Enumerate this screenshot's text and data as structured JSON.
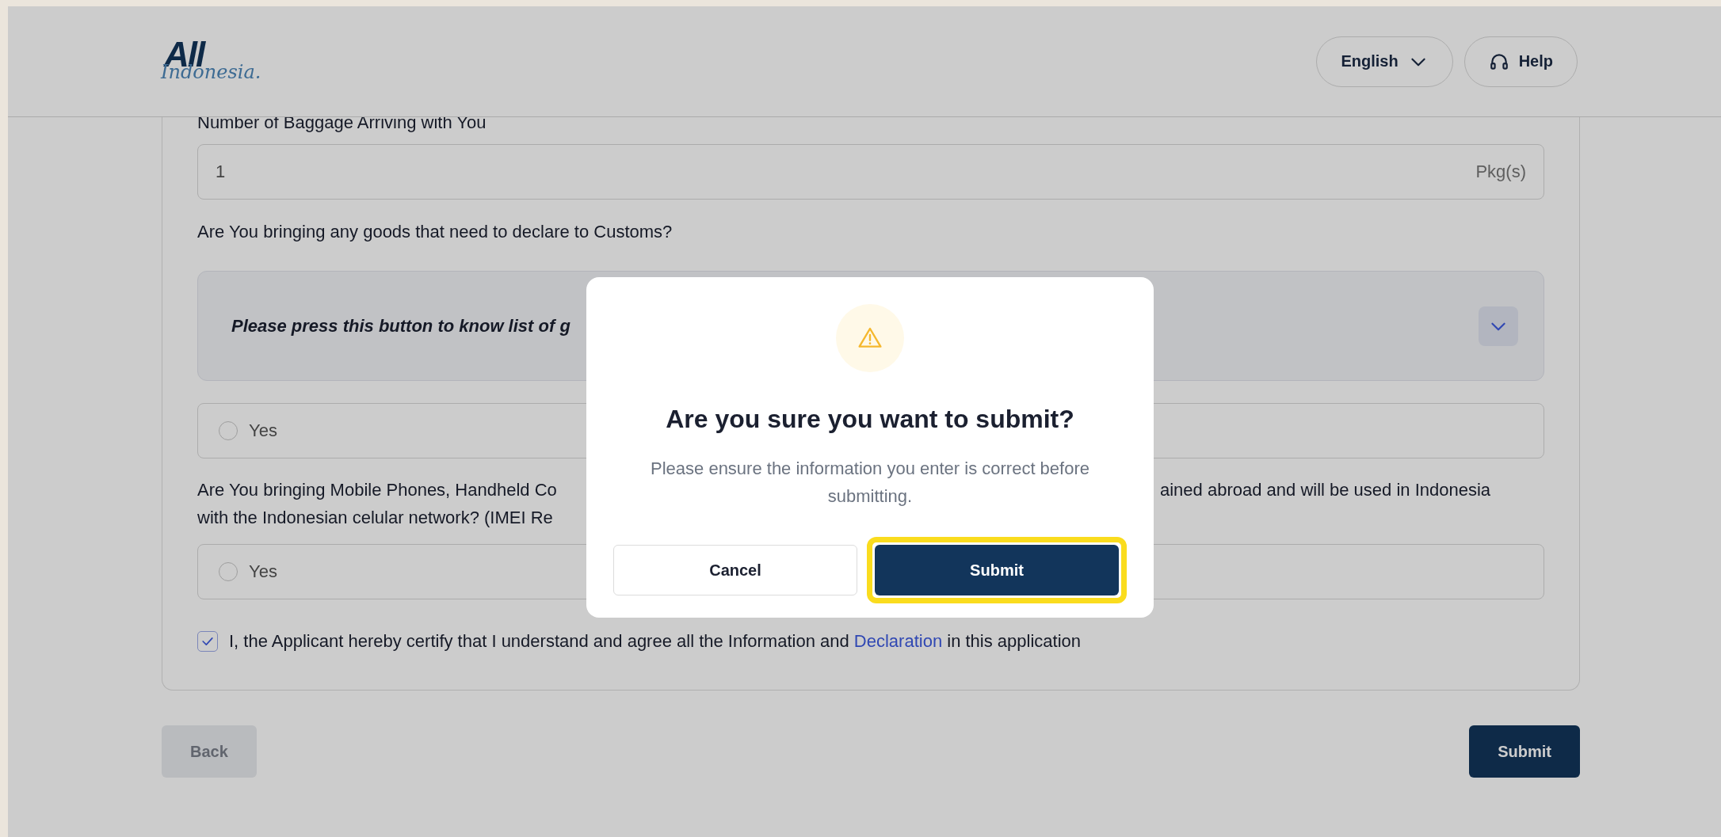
{
  "header": {
    "logo": {
      "bold": "All",
      "script": "Indonesia."
    },
    "language": "English",
    "help": "Help"
  },
  "baggage": {
    "label": "Number of Baggage Arriving with You",
    "value": "1",
    "unit": "Pkg(s)"
  },
  "customs": {
    "question": "Are You bringing any goods that need to declare to Customs?",
    "info": {
      "text": "Please press this button to know list of g",
      "expanded": false
    },
    "options": [
      {
        "label": "Yes",
        "selected": false
      }
    ]
  },
  "imei": {
    "question_lines": [
      {
        "left": "Are You bringing Mobile Phones, Handheld Co",
        "right": "ained abroad and will be used in Indonesia"
      },
      {
        "left": "with the Indonesian celular network? (IMEI Re"
      }
    ],
    "options": [
      {
        "label": "Yes",
        "selected": false
      }
    ]
  },
  "agreement": {
    "checked": true,
    "text_before": "I, the Applicant hereby certify that I understand and agree all the Information and",
    "link": "Declaration",
    "text_after": "in this application"
  },
  "actions": {
    "back": {
      "label": "Back",
      "disabled": true
    },
    "submit": {
      "label": "Submit",
      "disabled": false
    }
  },
  "dialog": {
    "title": "Are you sure you want to submit?",
    "message": "Please ensure the information you enter is correct before submitting.",
    "buttons": [
      {
        "label": "Cancel",
        "kind": "secondary",
        "highlighted": false
      },
      {
        "label": "Submit",
        "kind": "primary",
        "highlighted": true
      }
    ]
  }
}
